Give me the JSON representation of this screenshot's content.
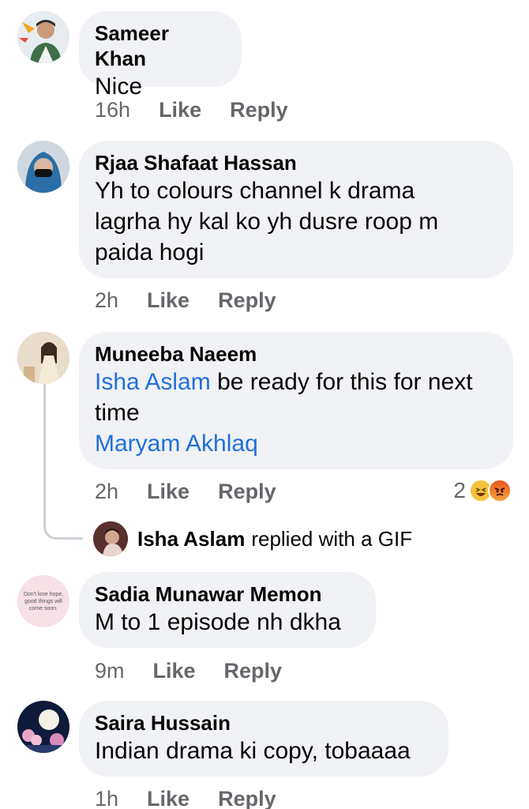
{
  "comments": [
    {
      "name": "Sameer Khan",
      "text": "Nice",
      "time": "16h",
      "like": "Like",
      "reply": "Reply"
    },
    {
      "name": "Rjaa Shafaat Hassan",
      "text_lines": [
        "Yh to colours channel k drama",
        "lagrha hy kal ko yh dusre roop m",
        "paida hogi"
      ],
      "time": "2h",
      "like": "Like",
      "reply": "Reply"
    },
    {
      "name": "Muneeba Naeem",
      "mention1": "Isha Aslam",
      "text_after": " be ready for this for next",
      "text_line2": "time",
      "mention2": "Maryam Akhlaq",
      "time": "2h",
      "like": "Like",
      "reply": "Reply",
      "reaction_count": "2",
      "reactions": [
        "haha-icon",
        "angry-icon"
      ]
    },
    {
      "name": "Sadia Munawar Memon",
      "text": "M to 1 episode nh dkha",
      "time": "9m",
      "like": "Like",
      "reply": "Reply",
      "avatar_text": "Don't lose hope, good things will come soon."
    },
    {
      "name": "Saira Hussain",
      "text": "Indian drama ki copy, tobaaaa",
      "time": "1h",
      "like": "Like",
      "reply": "Reply"
    }
  ],
  "gif_reply": {
    "name": "Isha Aslam",
    "text": "replied with a GIF"
  },
  "colors": {
    "bubble": "#f0f2f5",
    "mention": "#216fdb",
    "secondary": "#65676b"
  }
}
